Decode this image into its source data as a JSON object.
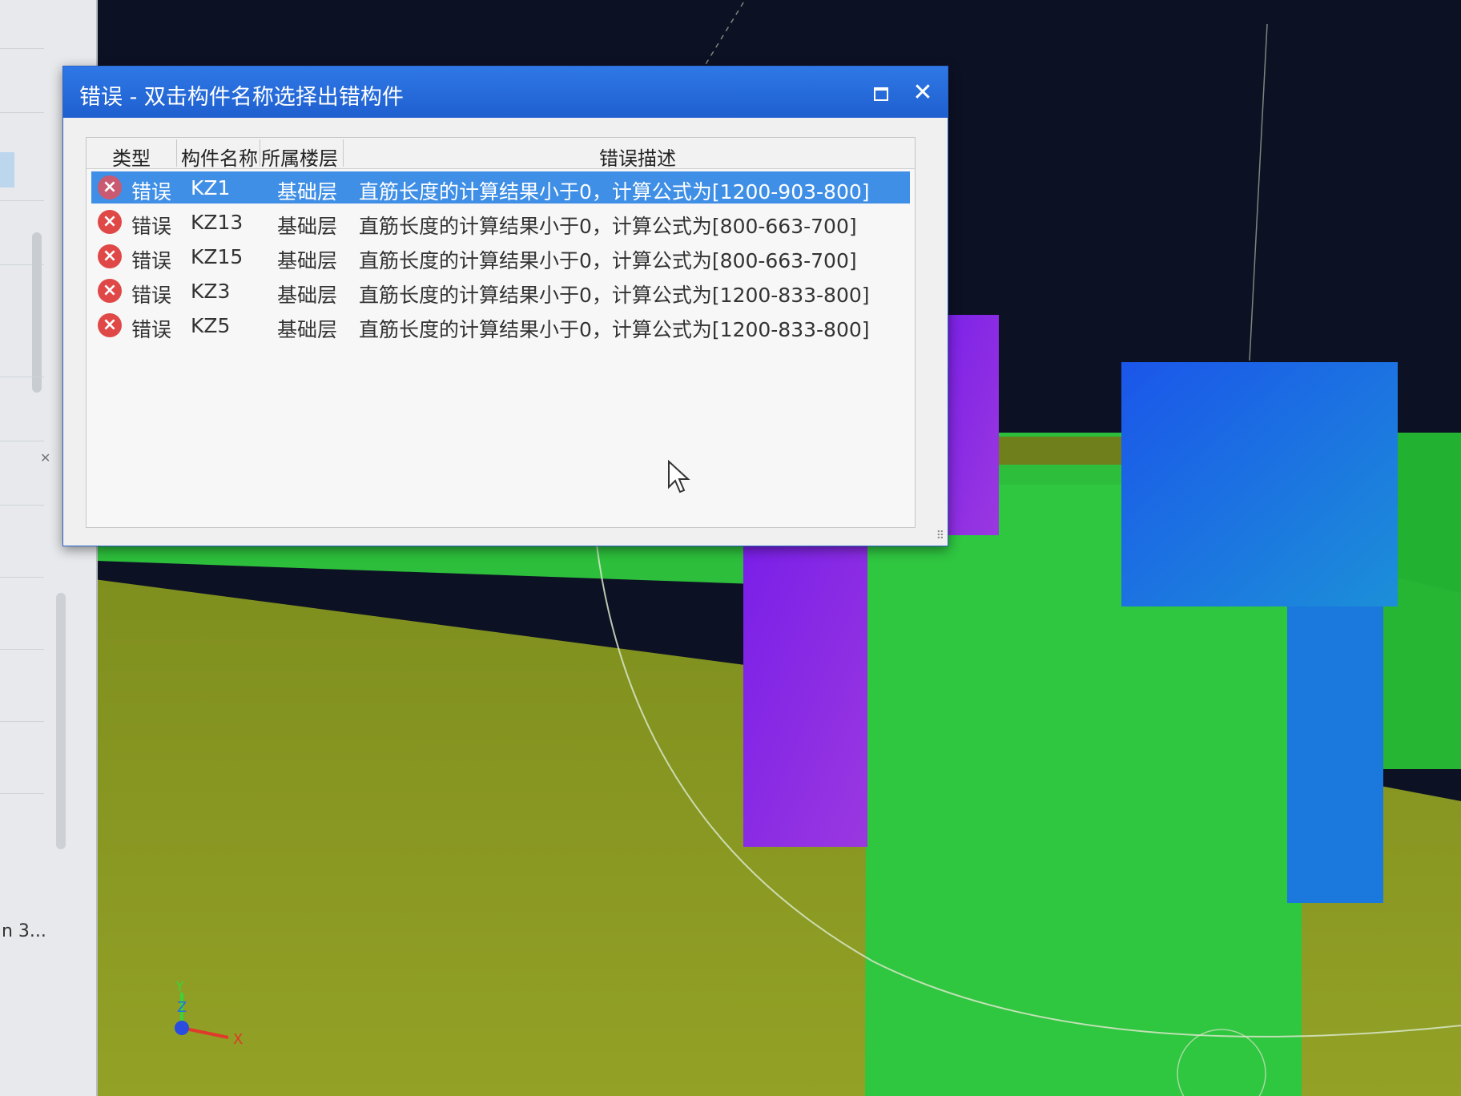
{
  "dialog": {
    "title": "错误 - 双击构件名称选择出错构件",
    "maximize_icon": "maximize-icon",
    "close_icon": "close-icon",
    "close_glyph": "✕"
  },
  "table": {
    "columns": [
      "类型",
      "构件名称",
      "所属楼层",
      "错误描述"
    ],
    "rows": [
      {
        "type": "错误",
        "name": "KZ1",
        "floor": "基础层",
        "desc": "直筋长度的计算结果小于0，计算公式为[1200-903-800]",
        "selected": true
      },
      {
        "type": "错误",
        "name": "KZ13",
        "floor": "基础层",
        "desc": "直筋长度的计算结果小于0，计算公式为[800-663-700]",
        "selected": false
      },
      {
        "type": "错误",
        "name": "KZ15",
        "floor": "基础层",
        "desc": "直筋长度的计算结果小于0，计算公式为[800-663-700]",
        "selected": false
      },
      {
        "type": "错误",
        "name": "KZ3",
        "floor": "基础层",
        "desc": "直筋长度的计算结果小于0，计算公式为[1200-833-800]",
        "selected": false
      },
      {
        "type": "错误",
        "name": "KZ5",
        "floor": "基础层",
        "desc": "直筋长度的计算结果小于0，计算公式为[1200-833-800]",
        "selected": false
      }
    ],
    "error_glyph": "×"
  },
  "side_panel": {
    "truncated_label": "n 3..."
  },
  "axes": {
    "x": "X",
    "y": "Y",
    "z": "Z"
  },
  "colors": {
    "title_bar": "#2f78e6",
    "selected_row": "#3f8fe6",
    "error_icon": "#e04848",
    "ground": "#8a9a22",
    "green_column": "#29c23a",
    "purple_column": "#8a2be6",
    "blue_column": "#1e62e8"
  }
}
